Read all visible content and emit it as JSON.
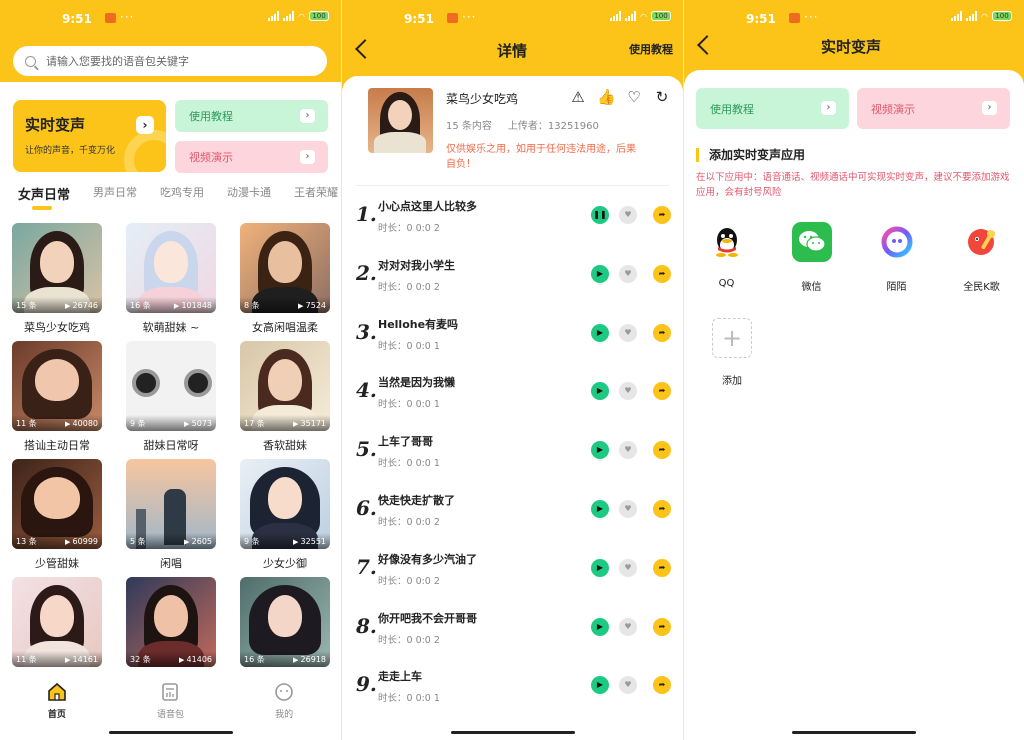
{
  "status": {
    "time": "9:51",
    "dots": "···",
    "battery": "100"
  },
  "colors": {
    "accent": "#fcc419",
    "green": "#1ec983",
    "pink": "#e2566c"
  },
  "home": {
    "search_placeholder": "请输入您要找的语音包关键字",
    "banner": {
      "title": "实时变声",
      "subtitle": "让你的声音，千变万化",
      "arrow": "›"
    },
    "chip_tutorial": "使用教程",
    "chip_video": "视频演示",
    "tabs": [
      "女声日常",
      "男声日常",
      "吃鸡专用",
      "动漫卡通",
      "王者荣耀"
    ],
    "cards": [
      {
        "name": "菜鸟少女吃鸡",
        "count": "15 条",
        "plays": "26746"
      },
      {
        "name": "软萌甜妹 ~",
        "count": "16 条",
        "plays": "101848"
      },
      {
        "name": "女高闲唱温柔",
        "count": "8 条",
        "plays": "7524"
      },
      {
        "name": "搭讪主动日常",
        "count": "11 条",
        "plays": "40080"
      },
      {
        "name": "甜妹日常呀",
        "count": "9 条",
        "plays": "5073"
      },
      {
        "name": "香软甜妹",
        "count": "17 条",
        "plays": "35171"
      },
      {
        "name": "少管甜妹",
        "count": "13 条",
        "plays": "60999"
      },
      {
        "name": "闲唱",
        "count": "5 条",
        "plays": "2605"
      },
      {
        "name": "少女少御",
        "count": "9 条",
        "plays": "32551"
      },
      {
        "name": "",
        "count": "11 条",
        "plays": "14161"
      },
      {
        "name": "",
        "count": "32 条",
        "plays": "41406"
      },
      {
        "name": "",
        "count": "16 条",
        "plays": "26918"
      }
    ],
    "nav": [
      "首页",
      "语音包",
      "我的"
    ]
  },
  "detail": {
    "title": "详情",
    "tutorial": "使用教程",
    "pack_title": "菜鸟少女吃鸡",
    "pack_count": "15 条内容",
    "uploader": "上传者：13251960",
    "warning": "仅供娱乐之用，如用于任何违法用途，后果自负！",
    "tracks": [
      {
        "num": "1.",
        "name": "小心点这里人比较多",
        "duration": "时长：0 0:0 2",
        "playing": true
      },
      {
        "num": "2.",
        "name": "对对对我小学生",
        "duration": "时长：0 0:0 2",
        "playing": false
      },
      {
        "num": "3.",
        "name": "Hellohe有麦吗",
        "duration": "时长：0 0:0 1",
        "playing": false
      },
      {
        "num": "4.",
        "name": "当然是因为我懒",
        "duration": "时长：0 0:0 1",
        "playing": false
      },
      {
        "num": "5.",
        "name": "上车了哥哥",
        "duration": "时长：0 0:0 1",
        "playing": false
      },
      {
        "num": "6.",
        "name": "快走快走扩散了",
        "duration": "时长：0 0:0 2",
        "playing": false
      },
      {
        "num": "7.",
        "name": "好像没有多少汽油了",
        "duration": "时长：0 0:0 2",
        "playing": false
      },
      {
        "num": "8.",
        "name": "你开吧我不会开哥哥",
        "duration": "时长：0 0:0 2",
        "playing": false
      },
      {
        "num": "9.",
        "name": "走走上车",
        "duration": "时长：0 0:0 1",
        "playing": false
      }
    ]
  },
  "realtime": {
    "title": "实时变声",
    "chip_tutorial": "使用教程",
    "chip_video": "视频演示",
    "section_title": "添加实时变声应用",
    "section_note": "在以下应用中：语音通话、视频通话中可实现实时变声，建议不要添加游戏应用，会有封号风险",
    "apps": [
      {
        "label": "QQ",
        "icon": "qq-icon"
      },
      {
        "label": "微信",
        "icon": "wechat-icon"
      },
      {
        "label": "陌陌",
        "icon": "momo-icon"
      },
      {
        "label": "全民K歌",
        "icon": "kge-icon"
      }
    ],
    "add_label": "添加"
  }
}
